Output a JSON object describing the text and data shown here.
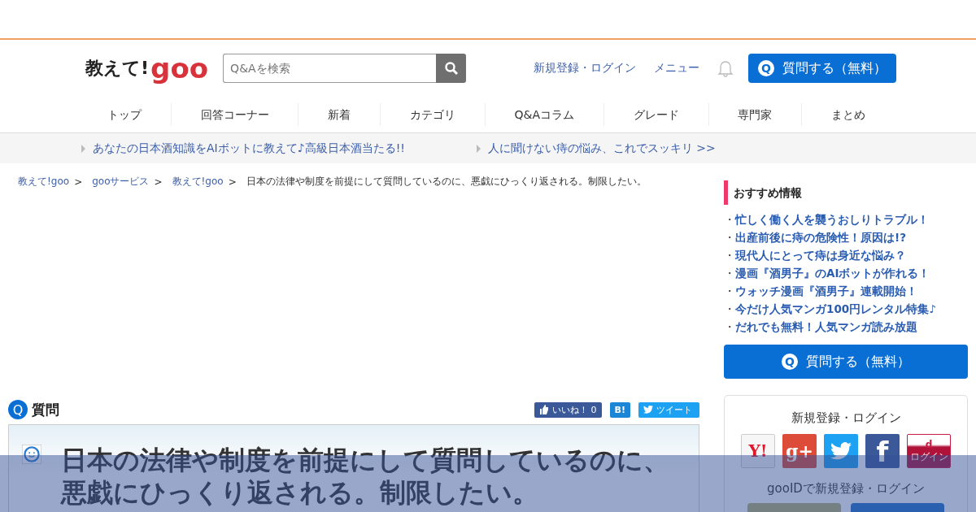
{
  "header": {
    "logo": {
      "text": "教えて!",
      "mark": "goo"
    },
    "search": {
      "placeholder": "Q&Aを検索"
    },
    "links": [
      "新規登録・ログイン",
      "メニュー"
    ],
    "ask_button": {
      "icon": "Q",
      "label": "質問する（無料）"
    }
  },
  "nav": [
    "トップ",
    "回答コーナー",
    "新着",
    "カテゴリ",
    "Q&Aコラム",
    "グレード",
    "専門家",
    "まとめ"
  ],
  "promos": [
    "あなたの日本酒知識をAIボットに教えて♪高級日本酒当たる!!",
    "人に聞けない痔の悩み、これでスッキリ >>"
  ],
  "breadcrumb": {
    "links": [
      "教えて!goo",
      "gooサービス",
      "教えて!goo"
    ],
    "separator": ">",
    "current": "日本の法律や制度を前提にして質問しているのに、悪戯にひっくり返される。制限したい。"
  },
  "question": {
    "icon": "Q",
    "heading": "質問",
    "like_button": {
      "label": "いいね！",
      "count": "0"
    },
    "hatena_button": "B!",
    "tweet_button": "ツイート",
    "title": "日本の法律や制度を前提にして質問しているのに、悪戯にひっくり返される。制限したい。"
  },
  "sidebar": {
    "heading": "おすすめ情報",
    "items": [
      {
        "bullet": "・",
        "text": "忙しく働く人を襲うおしりトラブル！"
      },
      {
        "bullet": "・",
        "text": "出産前後に痔の危険性！原因は!?"
      },
      {
        "bullet": "・",
        "text": "現代人にとって痔は身近な悩み？"
      },
      {
        "bullet": "・",
        "text": "漫画『酒男子』のAIボットが作れる！"
      },
      {
        "bullet": "・",
        "text": "ウォッチ漫画『酒男子』連載開始！"
      },
      {
        "bullet": "・",
        "text": "今だけ人気マンガ100円レンタル特集♪"
      },
      {
        "bullet": "・",
        "text": "だれでも無料！人気マンガ読み放題"
      }
    ],
    "ask_button": {
      "icon": "Q",
      "label": "質問する（無料）"
    },
    "login": {
      "heading": "新規登録・ログイン",
      "services": [
        {
          "kind": "yahoo",
          "label": "Y!"
        },
        {
          "kind": "gplus",
          "label": "g+"
        },
        {
          "kind": "twitter"
        },
        {
          "kind": "facebook",
          "label": "f"
        },
        {
          "kind": "docomo",
          "label": "d",
          "sub": "ログイン"
        }
      ],
      "goo_heading": "gooIDで新規登録・ログイン"
    }
  },
  "overlay": {
    "shown": true
  }
}
